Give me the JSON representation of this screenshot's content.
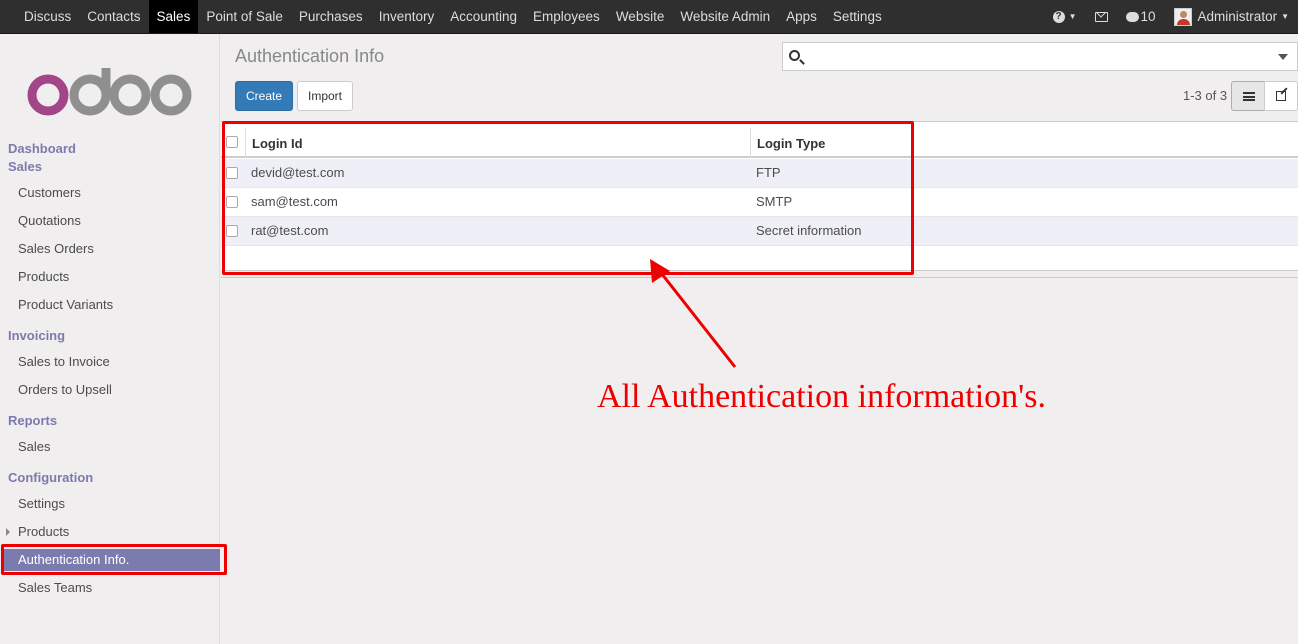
{
  "topbar": {
    "menu": [
      "Discuss",
      "Contacts",
      "Sales",
      "Point of Sale",
      "Purchases",
      "Inventory",
      "Accounting",
      "Employees",
      "Website",
      "Website Admin",
      "Apps",
      "Settings"
    ],
    "active": "Sales",
    "message_count": "10",
    "user": "Administrator"
  },
  "sidebar": {
    "logo_text": "odoo",
    "dashboard": "Dashboard",
    "sales_head": "Sales",
    "sales_items": [
      "Customers",
      "Quotations",
      "Sales Orders",
      "Products",
      "Product Variants"
    ],
    "invoicing_head": "Invoicing",
    "invoicing_items": [
      "Sales to Invoice",
      "Orders to Upsell"
    ],
    "reports_head": "Reports",
    "reports_items": [
      "Sales"
    ],
    "config_head": "Configuration",
    "config_items": [
      "Settings",
      "Products",
      "Authentication Info.",
      "Sales Teams"
    ],
    "active_item": "Authentication Info."
  },
  "main": {
    "title": "Authentication Info",
    "search": {
      "placeholder": "",
      "value": ""
    },
    "create_label": "Create",
    "import_label": "Import",
    "pager": "1-3 of 3",
    "columns": [
      "Login Id",
      "Login Type"
    ],
    "rows": [
      {
        "login_id": "devid@test.com",
        "login_type": "FTP"
      },
      {
        "login_id": "sam@test.com",
        "login_type": "SMTP"
      },
      {
        "login_id": "rat@test.com",
        "login_type": "Secret information"
      }
    ]
  },
  "annotation": {
    "text": "All Authentication information's.",
    "color": "#ee0000"
  },
  "colors": {
    "topbar_bg": "#2f2f2f",
    "accent": "#7c7bad",
    "primary_button": "#337ab7",
    "logo_purple": "#a24689",
    "logo_grey": "#8f8f8f"
  }
}
